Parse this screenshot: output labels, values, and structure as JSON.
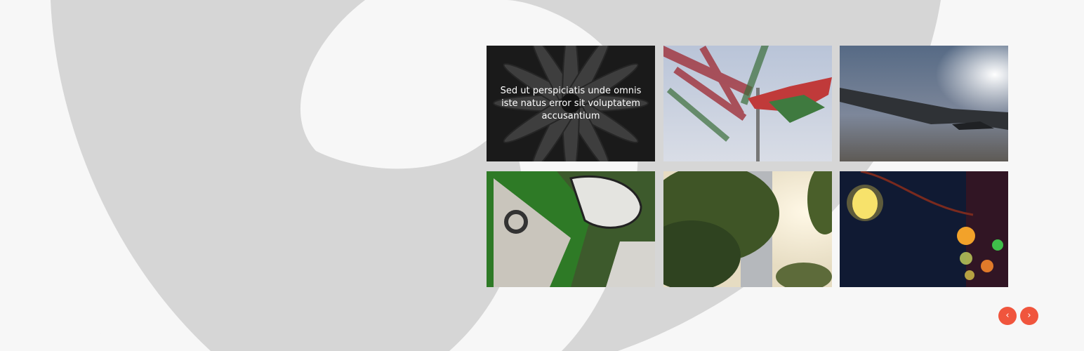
{
  "gallery": {
    "items": [
      {
        "icon": "fish-photo",
        "caption": "Sed ut perspiciatis unde omnis iste natus error sit voluptatem accusantium"
      },
      {
        "icon": "flags-photo"
      },
      {
        "icon": "airplane-wing-photo"
      },
      {
        "icon": "graffiti-photo"
      },
      {
        "icon": "trees-photo"
      },
      {
        "icon": "light-bulbs-photo"
      }
    ]
  },
  "controls": {
    "prev_label": "‹",
    "next_label": "›",
    "accent_color": "#f0553d"
  },
  "colors": {
    "background": "#d6d6d6",
    "swirl": "#f7f7f7"
  }
}
